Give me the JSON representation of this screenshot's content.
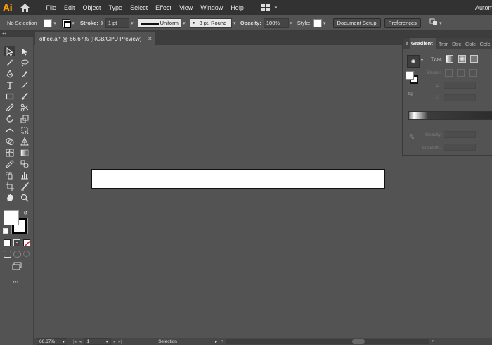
{
  "app": {
    "logo": "Ai",
    "automate_label": "Autom"
  },
  "menu": [
    "File",
    "Edit",
    "Object",
    "Type",
    "Select",
    "Effect",
    "View",
    "Window",
    "Help"
  ],
  "control": {
    "selection": "No Selection",
    "stroke_label": "Stroke:",
    "stroke_weight": "1 pt",
    "profile": "Uniform",
    "brush": "3 pt. Round",
    "opacity_label": "Opacity:",
    "opacity_value": "100%",
    "style_label": "Style:",
    "doc_setup": "Document Setup",
    "preferences": "Preferences"
  },
  "document": {
    "tab_title": "office.ai* @ 66.67% (RGB/GPU Preview)",
    "close": "×"
  },
  "toolbar": {
    "more": "•••"
  },
  "panel": {
    "tabs": [
      "Gradient",
      "Trar",
      "Strc",
      "Colc",
      "Colc"
    ],
    "type_label": "Type:",
    "stroke_label": "Stroke:",
    "opacity_label": "Opacity:",
    "location_label": "Location:"
  },
  "status": {
    "zoom": "66.67%",
    "artboard": "1",
    "tool": "Selection"
  },
  "colors": {
    "accent": "#ff9a00",
    "bg": "#535353",
    "menubar": "#323232"
  }
}
